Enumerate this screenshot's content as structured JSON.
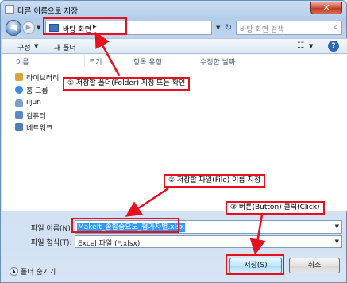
{
  "window": {
    "title": "다른 이름으로 저장",
    "close_label": "✕"
  },
  "nav": {
    "back_glyph": "◀",
    "forward_glyph": "▶",
    "address_text": "바탕 화면",
    "address_arrow": "▸",
    "refresh_glyph": "↻",
    "search_placeholder": "바탕 화면 검색",
    "search_glyph": "⌕"
  },
  "toolbar": {
    "organize_label": "구성",
    "new_folder_label": "새 폴더",
    "views_glyph": "☷",
    "help_label": "?"
  },
  "columns": [
    "이름",
    "크기",
    "항목 유형",
    "수정한 날짜"
  ],
  "sidebar": {
    "items": [
      {
        "label": "라이브러리",
        "icon": "library-icon",
        "color": "#d9a53b"
      },
      {
        "label": "홈 그룹",
        "icon": "homegroup-icon",
        "color": "#3a8dde"
      },
      {
        "label": "iljun",
        "icon": "user-icon",
        "color": "#7aa0c8"
      },
      {
        "label": "컴퓨터",
        "icon": "computer-icon",
        "color": "#5b89c4"
      },
      {
        "label": "네트워크",
        "icon": "network-icon",
        "color": "#4f7fb7"
      }
    ]
  },
  "form": {
    "filename_label": "파일 이름(N):",
    "filename_value": "MakeIt_종합중요도_평가자별.xlsx",
    "filetype_label": "파일 형식(T):",
    "filetype_value": "Excel 파일 (*.xlsx)",
    "hide_folders_label": "폴더 숨기기",
    "save_label": "저장(S)",
    "cancel_label": "취소"
  },
  "annotations": {
    "callout_1": "① 저장할 폴더(Folder) 지정 또는 확인",
    "callout_2": "② 저장할 파일(File) 이름 지정",
    "callout_3": "③ 버튼(Button) 클릭(Click)",
    "color": "#e8101f"
  }
}
